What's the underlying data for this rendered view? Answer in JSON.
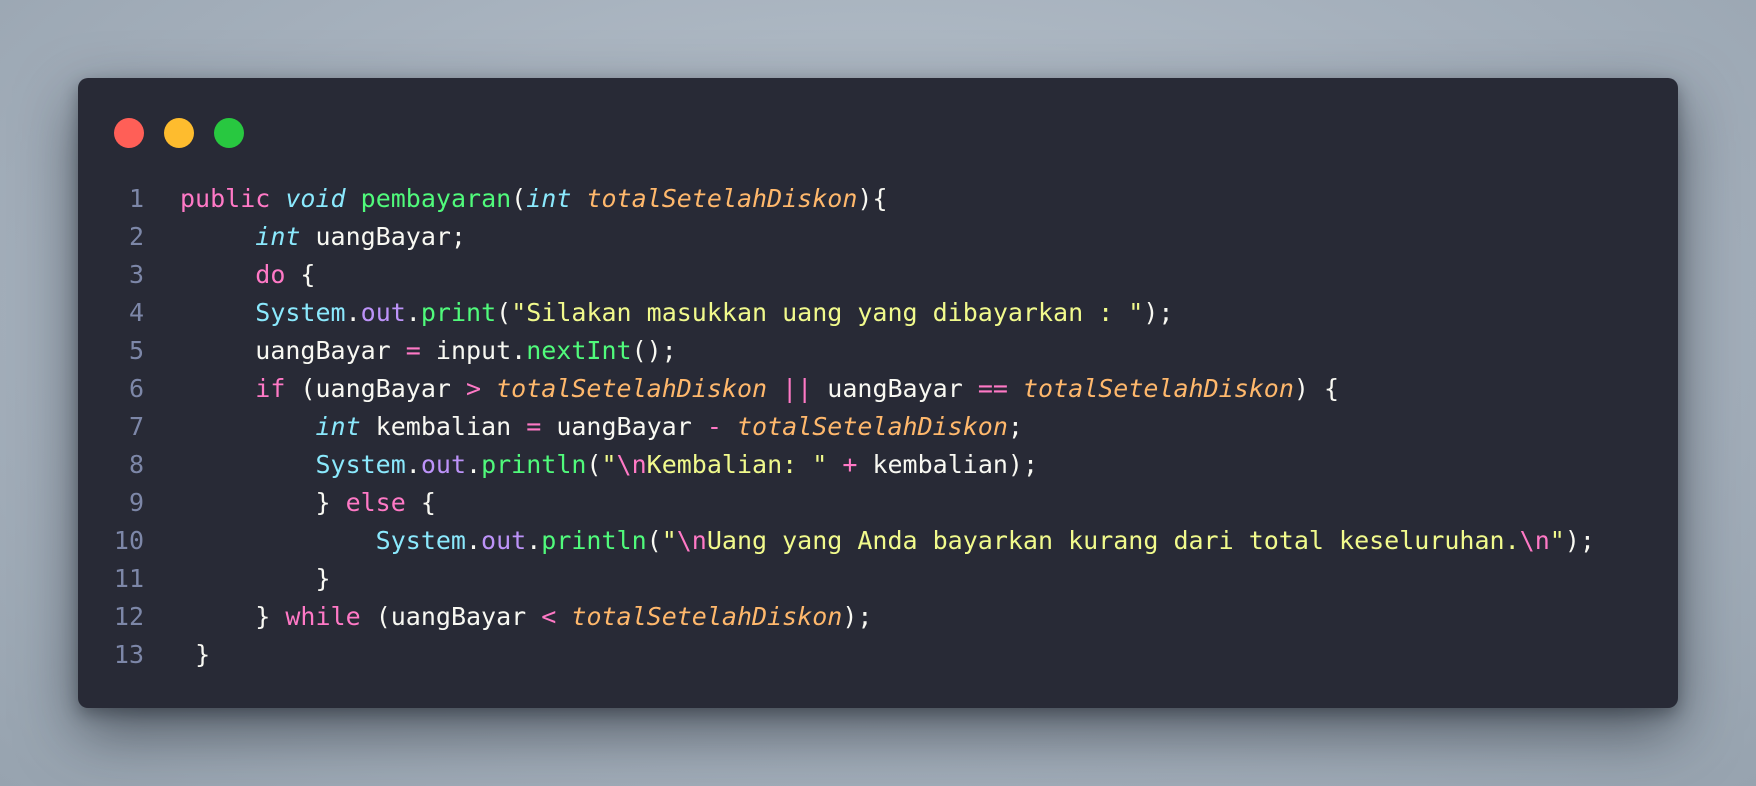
{
  "window": {
    "traffic_lights": [
      {
        "name": "close",
        "color": "#ff5f57"
      },
      {
        "name": "minimize",
        "color": "#febc2e"
      },
      {
        "name": "maximize",
        "color": "#28c840"
      }
    ]
  },
  "code": {
    "language": "java",
    "lines": [
      {
        "n": "1",
        "indent": "",
        "tokens": [
          {
            "t": "public",
            "c": "kw"
          },
          {
            "t": " ",
            "c": "pl"
          },
          {
            "t": "void",
            "c": "ty"
          },
          {
            "t": " ",
            "c": "pl"
          },
          {
            "t": "pembayaran",
            "c": "fn"
          },
          {
            "t": "(",
            "c": "pl"
          },
          {
            "t": "int",
            "c": "ty"
          },
          {
            "t": " ",
            "c": "pl"
          },
          {
            "t": "totalSetelahDiskon",
            "c": "pa"
          },
          {
            "t": "){",
            "c": "pl"
          }
        ]
      },
      {
        "n": "2",
        "indent": "     ",
        "tokens": [
          {
            "t": "int",
            "c": "ty"
          },
          {
            "t": " uangBayar;",
            "c": "pl"
          }
        ]
      },
      {
        "n": "3",
        "indent": "     ",
        "tokens": [
          {
            "t": "do",
            "c": "kw"
          },
          {
            "t": " {",
            "c": "pl"
          }
        ]
      },
      {
        "n": "4",
        "indent": "     ",
        "tokens": [
          {
            "t": "System",
            "c": "cl"
          },
          {
            "t": ".",
            "c": "pl"
          },
          {
            "t": "out",
            "c": "fi"
          },
          {
            "t": ".",
            "c": "pl"
          },
          {
            "t": "print",
            "c": "fn"
          },
          {
            "t": "(",
            "c": "pl"
          },
          {
            "t": "\"Silakan masukkan uang yang dibayarkan : \"",
            "c": "st"
          },
          {
            "t": ");",
            "c": "pl"
          }
        ]
      },
      {
        "n": "5",
        "indent": "     ",
        "tokens": [
          {
            "t": "uangBayar ",
            "c": "pl"
          },
          {
            "t": "=",
            "c": "op"
          },
          {
            "t": " input.",
            "c": "pl"
          },
          {
            "t": "nextInt",
            "c": "fn"
          },
          {
            "t": "();",
            "c": "pl"
          }
        ]
      },
      {
        "n": "6",
        "indent": "     ",
        "tokens": [
          {
            "t": "if",
            "c": "kw"
          },
          {
            "t": " (uangBayar ",
            "c": "pl"
          },
          {
            "t": ">",
            "c": "op"
          },
          {
            "t": " ",
            "c": "pl"
          },
          {
            "t": "totalSetelahDiskon",
            "c": "pa"
          },
          {
            "t": " ",
            "c": "pl"
          },
          {
            "t": "||",
            "c": "op"
          },
          {
            "t": " uangBayar ",
            "c": "pl"
          },
          {
            "t": "==",
            "c": "op"
          },
          {
            "t": " ",
            "c": "pl"
          },
          {
            "t": "totalSetelahDiskon",
            "c": "pa"
          },
          {
            "t": ") {",
            "c": "pl"
          }
        ]
      },
      {
        "n": "7",
        "indent": "         ",
        "tokens": [
          {
            "t": "int",
            "c": "ty"
          },
          {
            "t": " kembalian ",
            "c": "pl"
          },
          {
            "t": "=",
            "c": "op"
          },
          {
            "t": " uangBayar ",
            "c": "pl"
          },
          {
            "t": "-",
            "c": "op"
          },
          {
            "t": " ",
            "c": "pl"
          },
          {
            "t": "totalSetelahDiskon",
            "c": "pa"
          },
          {
            "t": ";",
            "c": "pl"
          }
        ]
      },
      {
        "n": "8",
        "indent": "         ",
        "tokens": [
          {
            "t": "System",
            "c": "cl"
          },
          {
            "t": ".",
            "c": "pl"
          },
          {
            "t": "out",
            "c": "fi"
          },
          {
            "t": ".",
            "c": "pl"
          },
          {
            "t": "println",
            "c": "fn"
          },
          {
            "t": "(",
            "c": "pl"
          },
          {
            "t": "\"",
            "c": "st"
          },
          {
            "t": "\\n",
            "c": "es"
          },
          {
            "t": "Kembalian: \"",
            "c": "st"
          },
          {
            "t": " ",
            "c": "pl"
          },
          {
            "t": "+",
            "c": "op"
          },
          {
            "t": " kembalian);",
            "c": "pl"
          }
        ]
      },
      {
        "n": "9",
        "indent": "         ",
        "tokens": [
          {
            "t": "} ",
            "c": "pl"
          },
          {
            "t": "else",
            "c": "kw"
          },
          {
            "t": " {",
            "c": "pl"
          }
        ]
      },
      {
        "n": "10",
        "indent": "             ",
        "tokens": [
          {
            "t": "System",
            "c": "cl"
          },
          {
            "t": ".",
            "c": "pl"
          },
          {
            "t": "out",
            "c": "fi"
          },
          {
            "t": ".",
            "c": "pl"
          },
          {
            "t": "println",
            "c": "fn"
          },
          {
            "t": "(",
            "c": "pl"
          },
          {
            "t": "\"",
            "c": "st"
          },
          {
            "t": "\\n",
            "c": "es"
          },
          {
            "t": "Uang yang Anda bayarkan kurang dari total keseluruhan.",
            "c": "st"
          },
          {
            "t": "\\n",
            "c": "es"
          },
          {
            "t": "\"",
            "c": "st"
          },
          {
            "t": ");",
            "c": "pl"
          }
        ]
      },
      {
        "n": "11",
        "indent": "         ",
        "tokens": [
          {
            "t": "}",
            "c": "pl"
          }
        ]
      },
      {
        "n": "12",
        "indent": "     ",
        "tokens": [
          {
            "t": "} ",
            "c": "pl"
          },
          {
            "t": "while",
            "c": "kw"
          },
          {
            "t": " (uangBayar ",
            "c": "pl"
          },
          {
            "t": "<",
            "c": "op"
          },
          {
            "t": " ",
            "c": "pl"
          },
          {
            "t": "totalSetelahDiskon",
            "c": "pa"
          },
          {
            "t": ");",
            "c": "pl"
          }
        ]
      },
      {
        "n": "13",
        "indent": " ",
        "tokens": [
          {
            "t": "}",
            "c": "pl"
          }
        ]
      }
    ]
  }
}
